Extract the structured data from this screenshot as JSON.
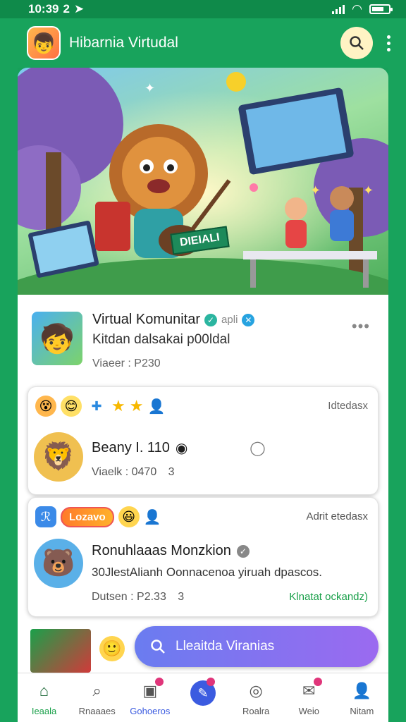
{
  "status": {
    "time": "10:39",
    "extra": "2"
  },
  "appbar": {
    "title": "Hibarnia Virtudal"
  },
  "hero": {
    "banner_text": "DIEIALI"
  },
  "post": {
    "title": "Virtual Komunitar",
    "handle": "apli",
    "subtitle": "Kitdan dalsakai p00ldal",
    "meta": "Viaeer : P230"
  },
  "card1": {
    "right_text": "Idtedasx",
    "title": "Beany I. 110",
    "meta": "Viaelk : 0470",
    "meta_count": "3"
  },
  "card2": {
    "pill": "Lozavo",
    "right_text": "Adrit etedasx",
    "title": "Ronuhlaaas Monzkion",
    "subtitle": "30JlestAlianh Oonnacenoa yiruah dpascos.",
    "meta": "Dutsen : P2.33",
    "meta_count": "3",
    "link": "Klnatat ockandz)"
  },
  "search": {
    "placeholder": "Lleaitda Viranias"
  },
  "nav": [
    {
      "label": "Ieaala"
    },
    {
      "label": "Rnaaaes"
    },
    {
      "label": "Gohoeros"
    },
    {
      "label": ""
    },
    {
      "label": "Roalra"
    },
    {
      "label": "Weio"
    },
    {
      "label": "Nitam"
    }
  ],
  "colors": {
    "primary": "#18a35c",
    "accent": "#3b5be0",
    "link": "#1aa04a"
  }
}
